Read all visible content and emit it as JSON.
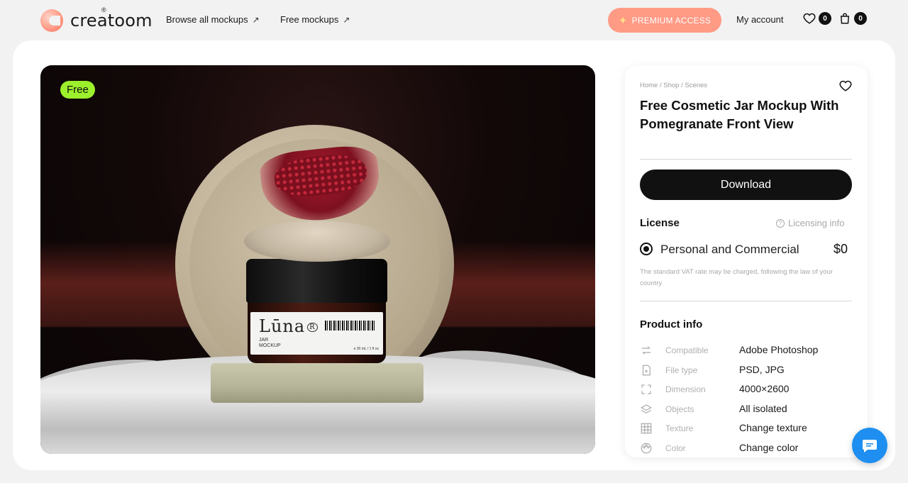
{
  "header": {
    "logo_text": "creatoom",
    "logo_mark": "®",
    "nav": [
      {
        "label": "Browse all mockups",
        "icon": "arrow-up-right-icon"
      },
      {
        "label": "Free mockups",
        "icon": "arrow-up-right-icon"
      }
    ],
    "premium_label": "PREMIUM ACCESS",
    "my_account_label": "My account",
    "wishlist_count": "0",
    "cart_count": "0"
  },
  "hero": {
    "badge": "Free",
    "jar_brand": "Lūna",
    "jar_brand_mark": "R",
    "jar_sub_1": "JAR",
    "jar_sub_2": "MOCKUP",
    "jar_volume": "e 30 mL / 1 fl oz"
  },
  "product": {
    "breadcrumb": "Home / Shop / Scenes",
    "title": "Free Cosmetic Jar Mockup With Pomegranate Front View",
    "download_label": "Download",
    "license_heading": "License",
    "licensing_info_label": "Licensing info",
    "license_option": "Personal and Commercial",
    "license_price": "$0",
    "vat_note": "The standard VAT rate may be charged, following the law of your country",
    "info_heading": "Product info",
    "info_rows": [
      {
        "icon": "arrows-swap-icon",
        "key": "Compatible",
        "value": "Adobe Photoshop"
      },
      {
        "icon": "file-icon",
        "key": "File type",
        "value": "PSD, JPG"
      },
      {
        "icon": "expand-icon",
        "key": "Dimension",
        "value": "4000×2600"
      },
      {
        "icon": "layers-icon",
        "key": "Objects",
        "value": "All isolated"
      },
      {
        "icon": "grid-icon",
        "key": "Texture",
        "value": "Change texture"
      },
      {
        "icon": "palette-icon",
        "key": "Color",
        "value": "Change color"
      }
    ]
  },
  "colors": {
    "premium": "#ff9a85",
    "free_badge": "#9cf02c",
    "chat": "#1e8ff0"
  }
}
